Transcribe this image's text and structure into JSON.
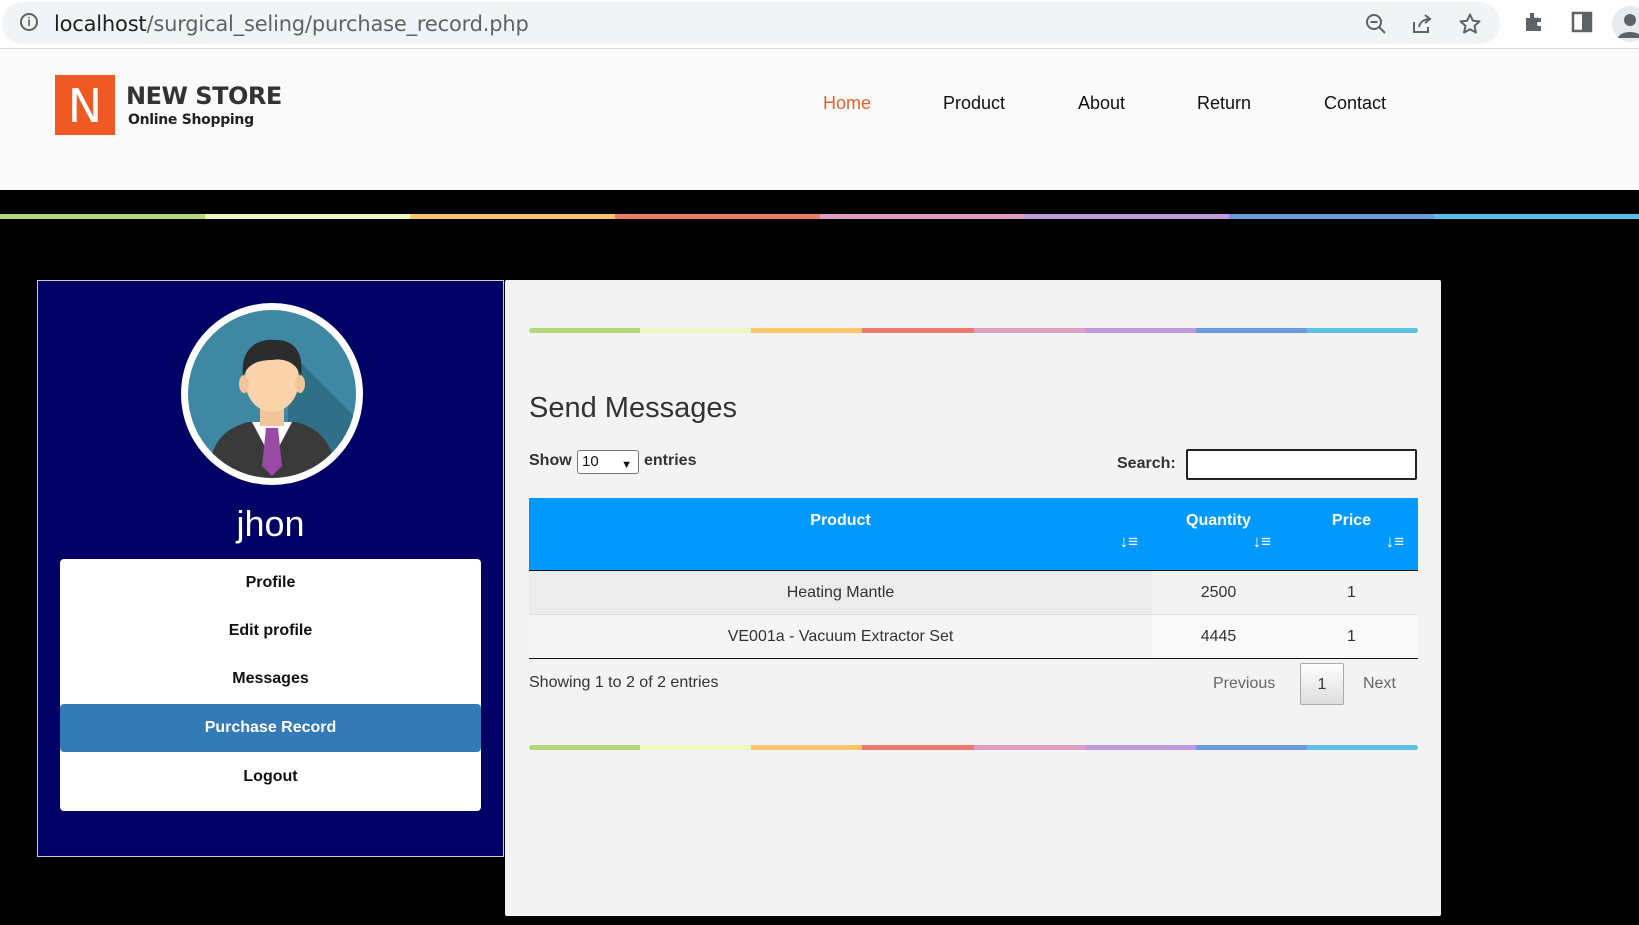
{
  "browser": {
    "url_host": "localhost",
    "url_path": "/surgical_seling/purchase_record.php"
  },
  "brand": {
    "logo_letter": "N",
    "title": "NEW STORE",
    "subtitle": "Online Shopping",
    "color": "#ef5a24"
  },
  "nav": [
    "Home",
    "Product",
    "About",
    "Return",
    "Contact"
  ],
  "rainbow_colors": [
    "#b5d97a",
    "#eef7c2",
    "#f8c46c",
    "#e87b6c",
    "#dc9ec1",
    "#c29bdc",
    "#6b9cdc",
    "#5cc0e2"
  ],
  "sidebar": {
    "username": "jhon",
    "menu": [
      "Profile",
      "Edit profile",
      "Messages",
      "Purchase Record",
      "Logout"
    ],
    "active_item": "Purchase Record"
  },
  "main": {
    "title": "Send Messages",
    "show_label": "Show",
    "entries_value": "10",
    "entries_label": "entries",
    "search_label": "Search:",
    "table": {
      "headers": [
        "Product",
        "Quantity",
        "Price"
      ],
      "rows": [
        [
          "Heating Mantle",
          "2500",
          "1"
        ],
        [
          "VE001a - Vacuum Extractor Set",
          "4445",
          "1"
        ]
      ]
    },
    "info": "Showing 1 to 2 of 2 entries",
    "pagination": {
      "previous": "Previous",
      "page": "1",
      "next": "Next"
    }
  }
}
